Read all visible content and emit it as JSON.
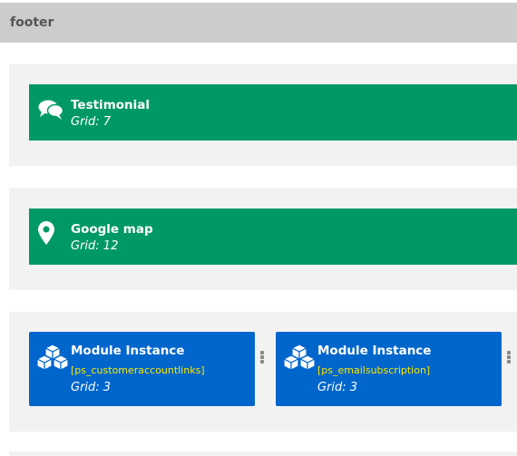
{
  "section": {
    "title": "footer"
  },
  "rows": [
    {
      "blocks": [
        {
          "title": "Testimonial",
          "grid": "Grid: 7",
          "icon": "comments-icon",
          "color": "#009966"
        }
      ]
    },
    {
      "blocks": [
        {
          "title": "Google map",
          "grid": "Grid: 12",
          "icon": "map-marker-icon",
          "color": "#009966"
        }
      ]
    },
    {
      "blocks": [
        {
          "title": "Module Instance",
          "tag": "[ps_customeraccountlinks]",
          "grid": "Grid: 3",
          "icon": "cubes-icon",
          "color": "#0066cc"
        },
        {
          "title": "Module Instance",
          "tag": "[ps_emailsubscription]",
          "grid": "Grid: 3",
          "icon": "cubes-icon",
          "color": "#0066cc"
        }
      ]
    }
  ],
  "colors": {
    "header_bg": "#cccccc",
    "row_bg": "#f2f2f2",
    "tag_text": "#ffe600"
  }
}
